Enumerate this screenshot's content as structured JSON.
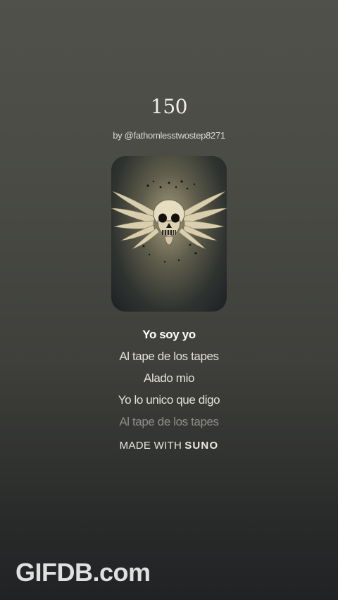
{
  "song": {
    "title": "150",
    "artist": "by @fathomlesstwostep8271"
  },
  "cover": {
    "icon": "winged-skull-artwork"
  },
  "lyrics": [
    "Yo soy yo",
    "Al tape de los tapes",
    "Alado mio",
    "Yo lo unico que digo",
    "Al tape de los tapes"
  ],
  "footer": {
    "made_with": "MADE WITH",
    "brand": "SUNO"
  },
  "watermark": "GIFDB.com",
  "colors": {
    "background_top": "#50514a",
    "background_bottom": "#202224",
    "text": "#e9e6df"
  }
}
